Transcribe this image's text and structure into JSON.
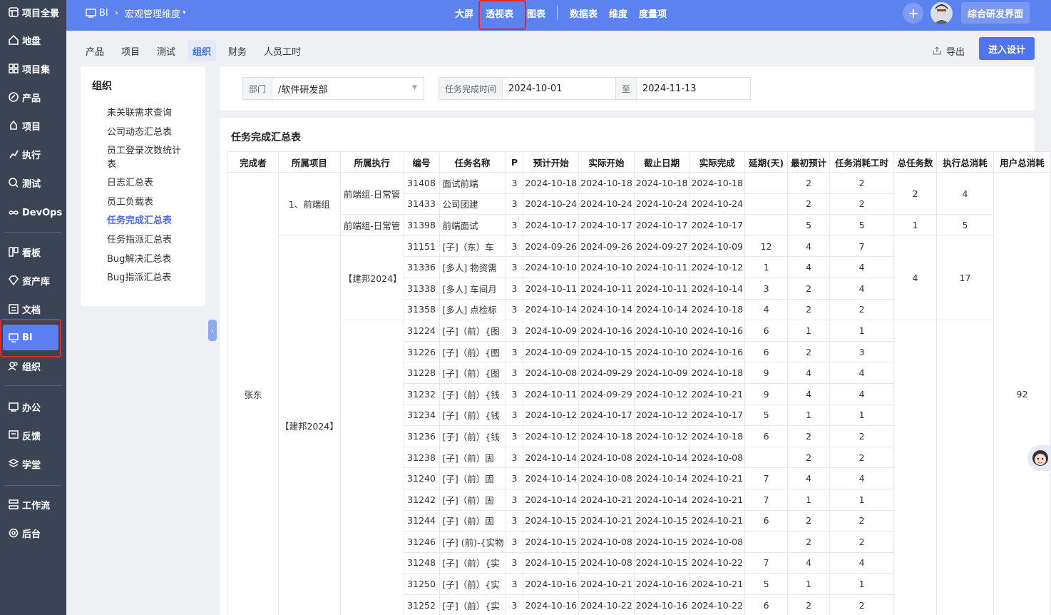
{
  "sidebar": {
    "items": [
      {
        "label": "项目全景",
        "icon": "dashboard-icon"
      },
      {
        "label": "地盘",
        "icon": "home-icon"
      },
      {
        "label": "项目集",
        "icon": "grid-icon"
      },
      {
        "label": "产品",
        "icon": "product-icon"
      },
      {
        "label": "项目",
        "icon": "project-icon"
      },
      {
        "label": "执行",
        "icon": "run-icon"
      },
      {
        "label": "测试",
        "icon": "search-icon"
      },
      {
        "label": "DevOps",
        "icon": "infinity-icon"
      },
      {
        "label": "看板",
        "icon": "kanban-icon"
      },
      {
        "label": "资产库",
        "icon": "diamond-icon"
      },
      {
        "label": "文档",
        "icon": "document-icon"
      },
      {
        "label": "BI",
        "icon": "monitor-icon"
      },
      {
        "label": "组织",
        "icon": "people-icon"
      },
      {
        "label": "办公",
        "icon": "oa-icon"
      },
      {
        "label": "反馈",
        "icon": "feedback-icon"
      },
      {
        "label": "学堂",
        "icon": "layers-icon"
      },
      {
        "label": "工作流",
        "icon": "workflow-icon"
      },
      {
        "label": "后台",
        "icon": "settings-icon"
      }
    ]
  },
  "topbar": {
    "app": "BI",
    "crumb": "宏观管理维度",
    "nav": [
      "大屏",
      "透视表",
      "图表",
      "数据表",
      "维度",
      "度量项"
    ],
    "active_nav": "透视表",
    "action_button": "综合研发界面"
  },
  "tabs": [
    "产品",
    "项目",
    "测试",
    "组织",
    "财务",
    "人员工时"
  ],
  "active_tab": "组织",
  "toolbar": {
    "export_label": "导出",
    "design_label": "进入设计"
  },
  "left_panel": {
    "title": "组织",
    "items": [
      "未关联需求查询",
      "公司动态汇总表",
      "员工登录次数统计表",
      "日志汇总表",
      "员工负载表",
      "任务完成汇总表",
      "任务指派汇总表",
      "Bug解决汇总表",
      "Bug指派汇总表"
    ],
    "active": "任务完成汇总表"
  },
  "filters": {
    "dept_label": "部门",
    "dept_value": "/软件研发部",
    "time_label": "任务完成时间",
    "date_from": "2024-10-01",
    "to_label": "至",
    "date_to": "2024-11-13"
  },
  "report": {
    "title": "任务完成汇总表",
    "columns": [
      "完成者",
      "所属项目",
      "所属执行",
      "编号",
      "任务名称",
      "P",
      "预计开始",
      "实际开始",
      "截止日期",
      "实际完成",
      "延期(天)",
      "最初预计",
      "任务消耗工时",
      "总任务数",
      "执行总消耗",
      "用户总消耗"
    ],
    "assignee": "张东",
    "user_total": "92",
    "projects": [
      "1、前端组",
      "【建邦2024】"
    ],
    "groups": [
      {
        "exec": "前端组-日常管",
        "total_tasks": "2",
        "exec_total": "4"
      },
      {
        "exec": "前端组-日常管",
        "total_tasks": "1",
        "exec_total": "5"
      },
      {
        "exec": "【建邦2024】",
        "total_tasks": "4",
        "exec_total": "17"
      },
      {
        "exec": "",
        "total_tasks": "",
        "exec_total": ""
      }
    ],
    "rows": [
      {
        "id": "31408",
        "name": "面试前端",
        "p": "3",
        "plan": "2024-10-18",
        "start": "2024-10-18",
        "due": "2024-10-18",
        "done": "2024-10-18",
        "delay": "",
        "est": "2",
        "cost": "2"
      },
      {
        "id": "31433",
        "name": "公司团建",
        "p": "3",
        "plan": "2024-10-24",
        "start": "2024-10-24",
        "due": "2024-10-24",
        "done": "2024-10-24",
        "delay": "",
        "est": "2",
        "cost": "2"
      },
      {
        "id": "31398",
        "name": "前端面试",
        "p": "3",
        "plan": "2024-10-17",
        "start": "2024-10-17",
        "due": "2024-10-17",
        "done": "2024-10-17",
        "delay": "",
        "est": "5",
        "cost": "5"
      },
      {
        "id": "31151",
        "name": "[子]（东）车",
        "p": "3",
        "plan": "2024-09-26",
        "start": "2024-09-26",
        "due": "2024-09-27",
        "done": "2024-10-09",
        "delay": "12",
        "est": "4",
        "cost": "7"
      },
      {
        "id": "31336",
        "name": "[多人] 物资需",
        "p": "3",
        "plan": "2024-10-10",
        "start": "2024-10-10",
        "due": "2024-10-11",
        "done": "2024-10-12",
        "delay": "1",
        "est": "4",
        "cost": "4"
      },
      {
        "id": "31338",
        "name": "[多人] 车间月",
        "p": "3",
        "plan": "2024-10-11",
        "start": "2024-10-11",
        "due": "2024-10-11",
        "done": "2024-10-14",
        "delay": "3",
        "est": "2",
        "cost": "4"
      },
      {
        "id": "31358",
        "name": "[多人] 点检标",
        "p": "3",
        "plan": "2024-10-14",
        "start": "2024-10-14",
        "due": "2024-10-14",
        "done": "2024-10-18",
        "delay": "4",
        "est": "2",
        "cost": "2"
      },
      {
        "id": "31224",
        "name": "[子]（前）{图",
        "p": "3",
        "plan": "2024-10-09",
        "start": "2024-10-16",
        "due": "2024-10-10",
        "done": "2024-10-16",
        "delay": "6",
        "est": "1",
        "cost": "1"
      },
      {
        "id": "31226",
        "name": "[子]（前）{图",
        "p": "3",
        "plan": "2024-10-09",
        "start": "2024-10-15",
        "due": "2024-10-10",
        "done": "2024-10-16",
        "delay": "6",
        "est": "2",
        "cost": "3"
      },
      {
        "id": "31228",
        "name": "[子]（前）{图",
        "p": "3",
        "plan": "2024-10-08",
        "start": "2024-09-29",
        "due": "2024-10-09",
        "done": "2024-10-18",
        "delay": "9",
        "est": "4",
        "cost": "4"
      },
      {
        "id": "31232",
        "name": "[子]（前）{钱",
        "p": "3",
        "plan": "2024-10-11",
        "start": "2024-09-29",
        "due": "2024-10-12",
        "done": "2024-10-21",
        "delay": "9",
        "est": "4",
        "cost": "4"
      },
      {
        "id": "31234",
        "name": "[子]（前）{钱",
        "p": "3",
        "plan": "2024-10-12",
        "start": "2024-10-17",
        "due": "2024-10-12",
        "done": "2024-10-17",
        "delay": "5",
        "est": "1",
        "cost": "1"
      },
      {
        "id": "31236",
        "name": "[子]（前）{钱",
        "p": "3",
        "plan": "2024-10-12",
        "start": "2024-10-18",
        "due": "2024-10-12",
        "done": "2024-10-18",
        "delay": "6",
        "est": "2",
        "cost": "2"
      },
      {
        "id": "31238",
        "name": "[子]（前）固",
        "p": "3",
        "plan": "2024-10-14",
        "start": "2024-10-08",
        "due": "2024-10-14",
        "done": "2024-10-08",
        "delay": "",
        "est": "2",
        "cost": "2"
      },
      {
        "id": "31240",
        "name": "[子]（前）固",
        "p": "3",
        "plan": "2024-10-14",
        "start": "2024-10-08",
        "due": "2024-10-14",
        "done": "2024-10-21",
        "delay": "7",
        "est": "4",
        "cost": "4"
      },
      {
        "id": "31242",
        "name": "[子]（前）固",
        "p": "3",
        "plan": "2024-10-14",
        "start": "2024-10-21",
        "due": "2024-10-14",
        "done": "2024-10-21",
        "delay": "7",
        "est": "1",
        "cost": "1"
      },
      {
        "id": "31244",
        "name": "[子]（前）固",
        "p": "3",
        "plan": "2024-10-15",
        "start": "2024-10-21",
        "due": "2024-10-15",
        "done": "2024-10-21",
        "delay": "6",
        "est": "2",
        "cost": "2"
      },
      {
        "id": "31246",
        "name": "[子] (前)-{实物",
        "p": "3",
        "plan": "2024-10-15",
        "start": "2024-10-08",
        "due": "2024-10-15",
        "done": "2024-10-08",
        "delay": "",
        "est": "2",
        "cost": "2"
      },
      {
        "id": "31248",
        "name": "[子]（前）{实",
        "p": "3",
        "plan": "2024-10-15",
        "start": "2024-10-08",
        "due": "2024-10-15",
        "done": "2024-10-22",
        "delay": "7",
        "est": "4",
        "cost": "4"
      },
      {
        "id": "31250",
        "name": "[子]（前）{实",
        "p": "3",
        "plan": "2024-10-16",
        "start": "2024-10-21",
        "due": "2024-10-16",
        "done": "2024-10-21",
        "delay": "5",
        "est": "1",
        "cost": "1"
      },
      {
        "id": "31252",
        "name": "[子]（前）{实",
        "p": "3",
        "plan": "2024-10-16",
        "start": "2024-10-22",
        "due": "2024-10-16",
        "done": "2024-10-22",
        "delay": "6",
        "est": "2",
        "cost": "2"
      }
    ]
  },
  "colors": {
    "sidebar": "#3b4455",
    "topbar": "#5b82ee",
    "accent": "#4a6ae8",
    "highlight": "#e02b2b"
  }
}
